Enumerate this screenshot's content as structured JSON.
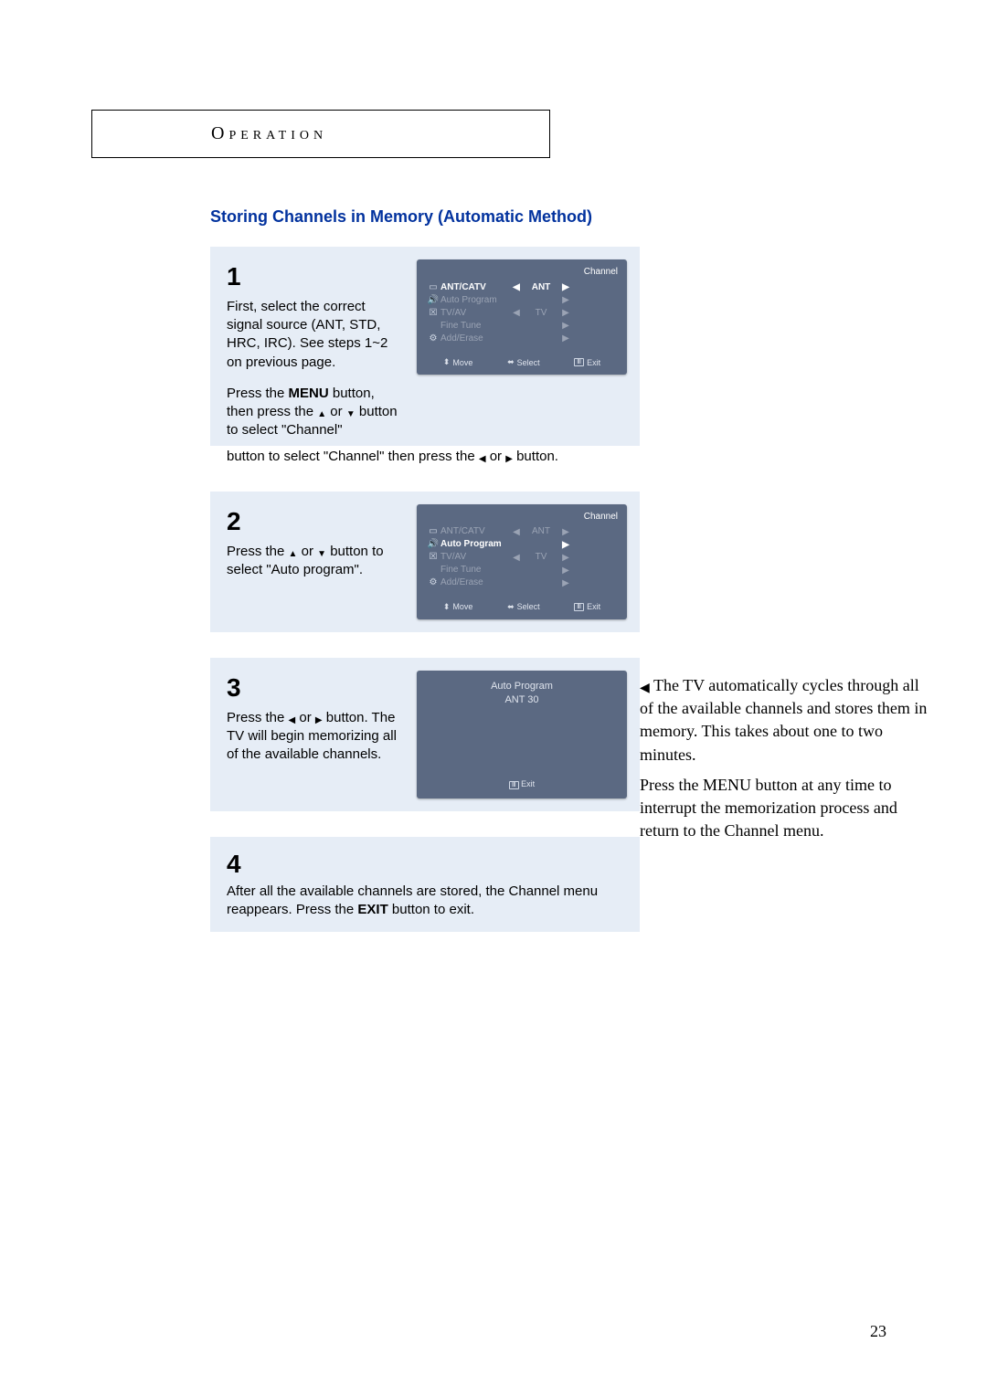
{
  "header": "Operation",
  "section_title": "Storing Channels in Memory (Automatic Method)",
  "page_number": "23",
  "osd_common": {
    "title": "Channel",
    "rows": [
      {
        "label": "ANT/CATV",
        "val": "ANT",
        "has_left": true,
        "has_right": true
      },
      {
        "label": "Auto Program",
        "val": "",
        "has_left": false,
        "has_right": true
      },
      {
        "label": "TV/AV",
        "val": "TV",
        "has_left": true,
        "has_right": true
      },
      {
        "label": "Fine Tune",
        "val": "",
        "has_left": false,
        "has_right": true
      },
      {
        "label": "Add/Erase",
        "val": "",
        "has_left": false,
        "has_right": true
      }
    ],
    "footer_move": "Move",
    "footer_select": "Select",
    "footer_exit": "Exit"
  },
  "step1": {
    "num": "1",
    "text_a": "First, select the correct signal source (ANT, STD, HRC, IRC). See steps 1~2 on previous page.",
    "text_b1": "Press the ",
    "text_b_menu": "MENU",
    "text_b2": " button, then press the ",
    "text_b3": " or ",
    "text_b4": " button to select \"Channel\" then press the ",
    "text_b5": " or ",
    "text_b6": " button."
  },
  "step2": {
    "num": "2",
    "text1": "Press the ",
    "text2": " or ",
    "text3": " button to select \"Auto program\"."
  },
  "step3": {
    "num": "3",
    "text1": "Press the ",
    "text2": " or ",
    "text3": " button. The TV will begin memorizing all of the available channels.",
    "osd_title": "Auto Program",
    "osd_line": "ANT    30",
    "osd_exit": "Exit"
  },
  "side_note": {
    "p1": " The TV automatically cycles through all of the available channels and stores them in memory. This takes about one to two minutes.",
    "p2": "Press the MENU button at any time to interrupt the memorization process and return to the Channel menu."
  },
  "step4": {
    "num": "4",
    "text1": "After all the available channels are stored, the Channel menu reappears. Press the ",
    "text_exit": "EXIT",
    "text2": " button to exit."
  }
}
